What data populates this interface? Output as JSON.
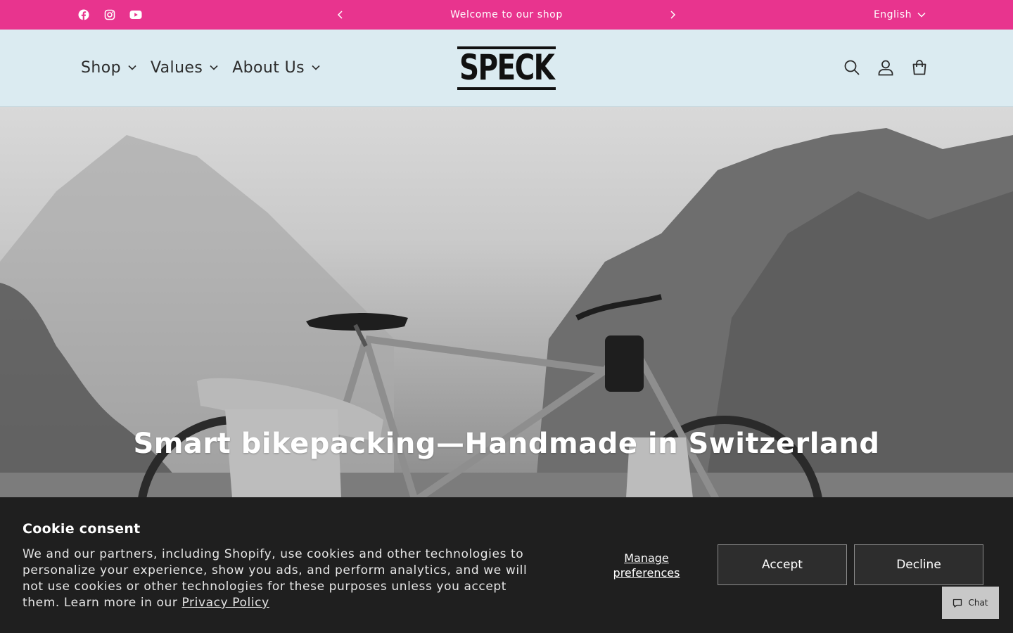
{
  "announcement": {
    "message": "Welcome to our shop",
    "language": "English",
    "social": [
      "facebook-icon",
      "instagram-icon",
      "youtube-icon"
    ],
    "bg_color": "#e8348e"
  },
  "header": {
    "logo": "SPECK",
    "nav": [
      {
        "label": "Shop"
      },
      {
        "label": "Values"
      },
      {
        "label": "About Us"
      }
    ],
    "icons": [
      "search-icon",
      "account-icon",
      "cart-icon"
    ],
    "bg_color": "#dbebf1"
  },
  "hero": {
    "title": "Smart bikepacking—Handmade in Switzerland"
  },
  "cookie": {
    "title": "Cookie consent",
    "text": "We and our partners, including Shopify, use cookies and other technologies to personalize your experience, show you ads, and perform analytics, and we will not use cookies or other technologies for these purposes unless you accept them. Learn more in our ",
    "link": "Privacy Policy",
    "manage": "Manage preferences",
    "accept": "Accept",
    "decline": "Decline"
  },
  "chat": {
    "label": "Chat"
  }
}
